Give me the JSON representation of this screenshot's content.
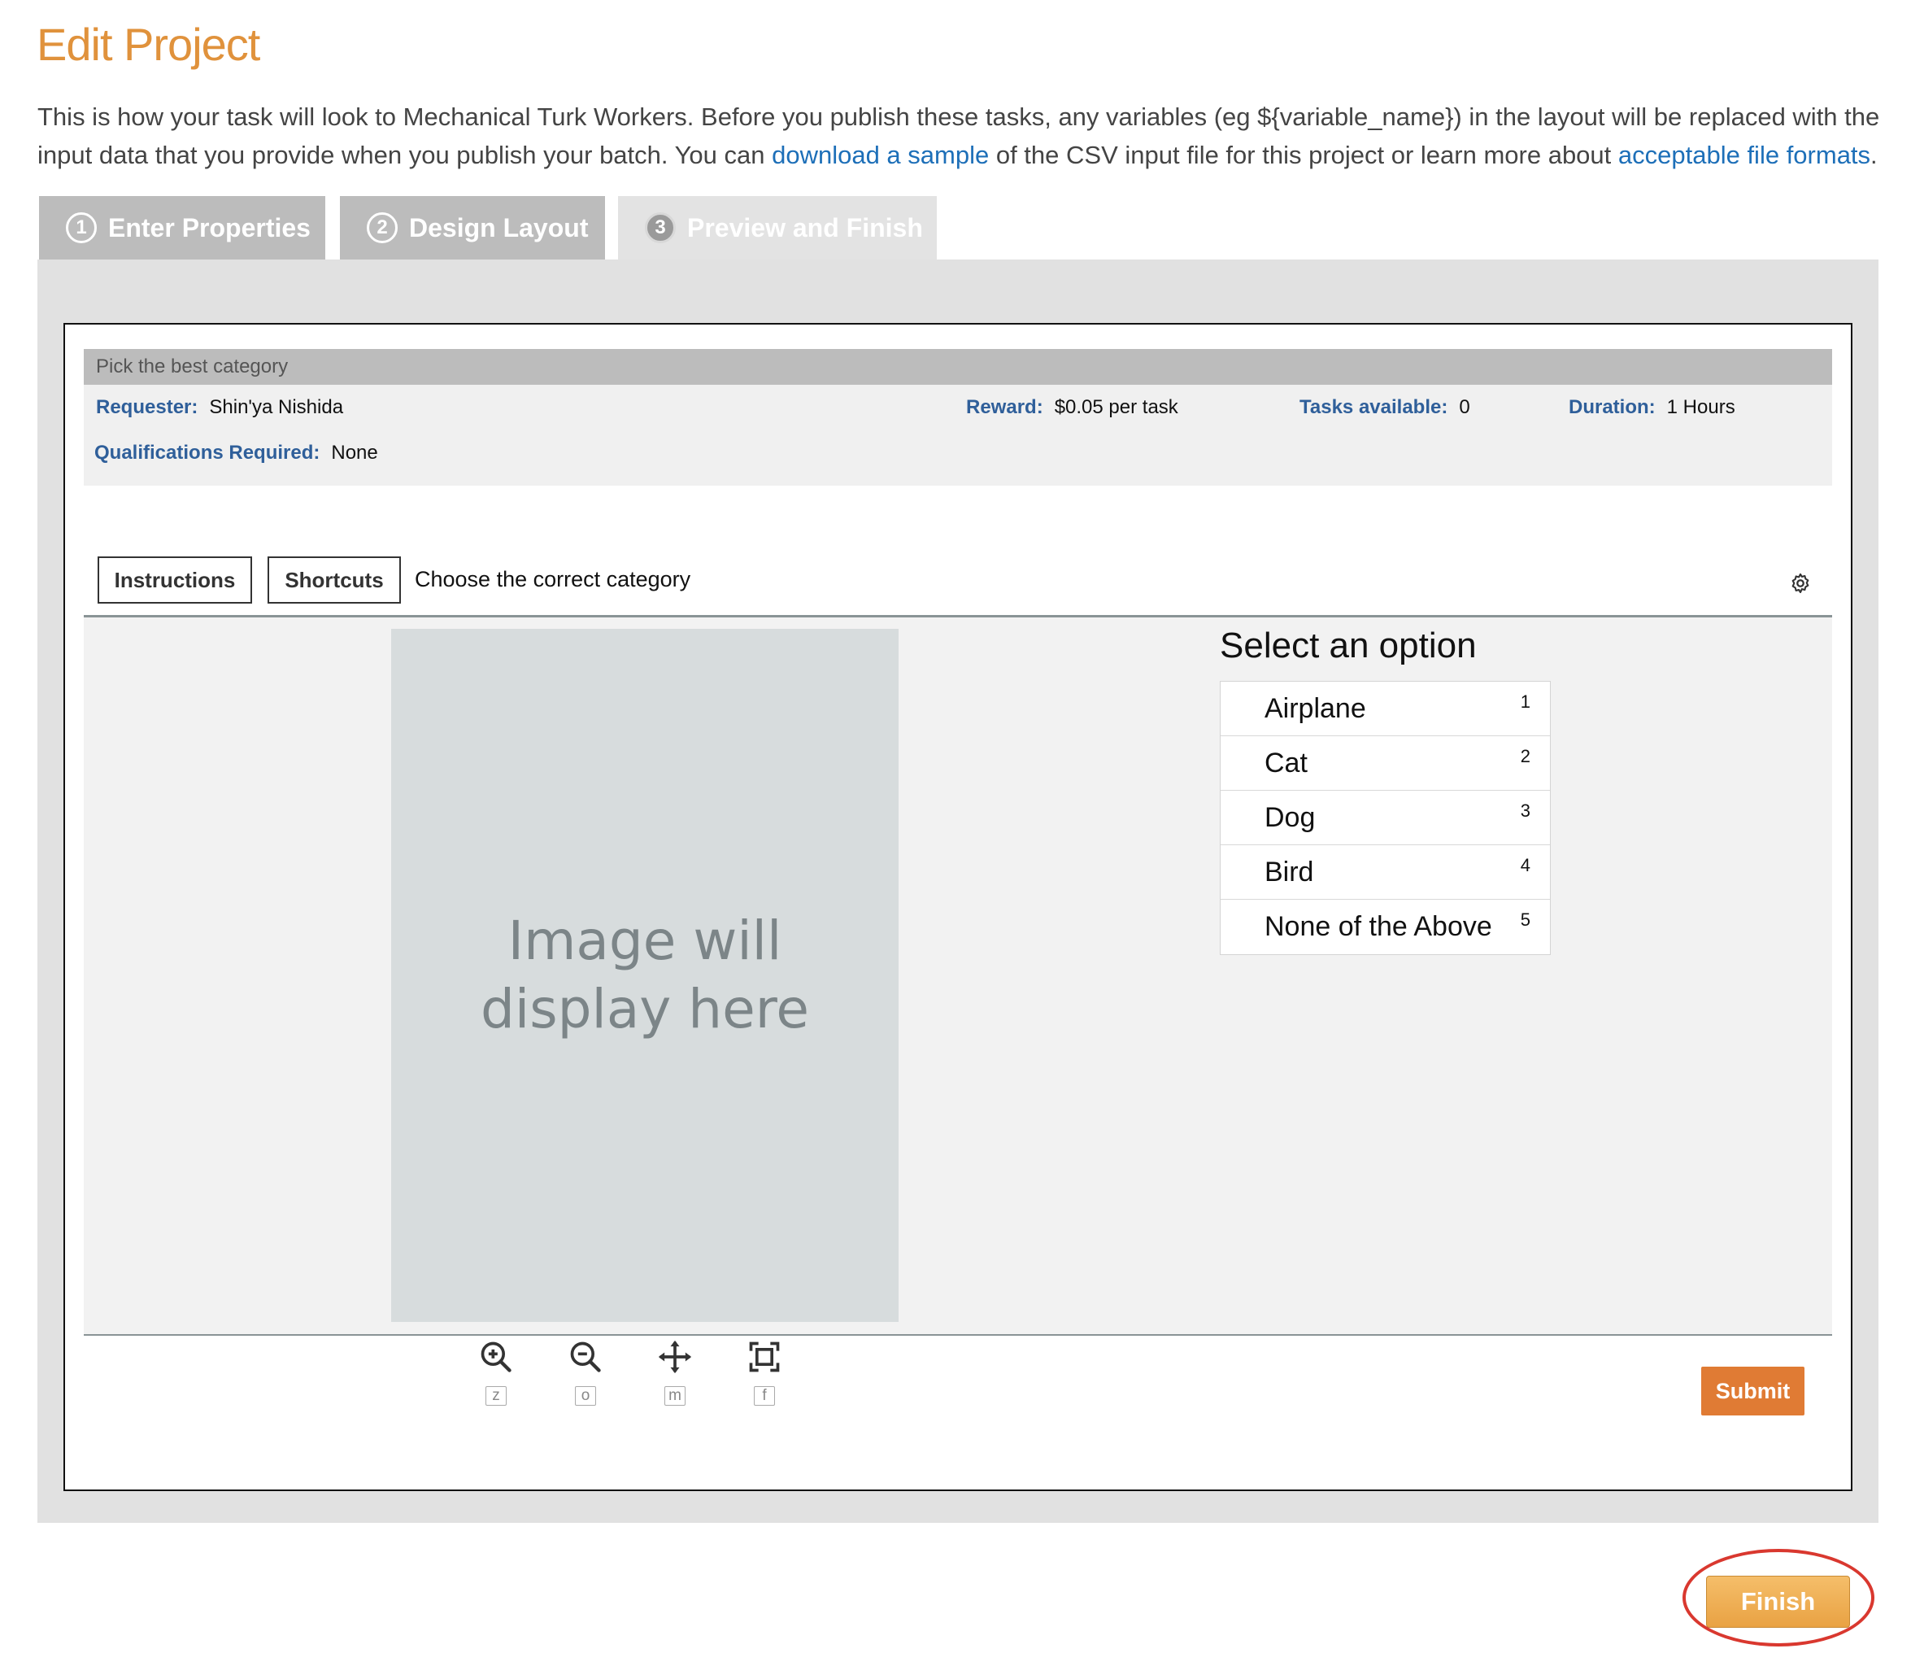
{
  "page": {
    "title": "Edit Project",
    "intro_part1": "This is how your task will look to Mechanical Turk Workers. Before you publish these tasks, any variables (eg ${variable_name}) in the layout will be replaced with the input data that you provide when you publish your batch. You can ",
    "intro_link1": "download a sample",
    "intro_part2": " of the CSV input file for this project or learn more about ",
    "intro_link2": "acceptable file formats",
    "intro_part3": "."
  },
  "tabs": [
    {
      "num": "1",
      "label": "Enter Properties"
    },
    {
      "num": "2",
      "label": "Design Layout"
    },
    {
      "num": "3",
      "label": "Preview and Finish"
    }
  ],
  "hit": {
    "title": "Pick the best category",
    "requester_label": "Requester:",
    "requester_value": "Shin'ya Nishida",
    "reward_label": "Reward:",
    "reward_value": "$0.05 per task",
    "tasks_label": "Tasks available:",
    "tasks_value": "0",
    "duration_label": "Duration:",
    "duration_value": "1 Hours",
    "quals_label": "Qualifications Required:",
    "quals_value": "None"
  },
  "task": {
    "instructions_label": "Instructions",
    "shortcuts_label": "Shortcuts",
    "prompt": "Choose the correct category",
    "image_placeholder_line1": "Image will",
    "image_placeholder_line2": "display here",
    "select_title": "Select an option",
    "options": [
      {
        "label": "Airplane",
        "key": "1"
      },
      {
        "label": "Cat",
        "key": "2"
      },
      {
        "label": "Dog",
        "key": "3"
      },
      {
        "label": "Bird",
        "key": "4"
      },
      {
        "label": "None of the Above",
        "key": "5"
      }
    ],
    "tools": [
      {
        "icon": "zoom-in-icon",
        "key": "z"
      },
      {
        "icon": "zoom-out-icon",
        "key": "o"
      },
      {
        "icon": "move-icon",
        "key": "m"
      },
      {
        "icon": "fit-icon",
        "key": "f"
      }
    ],
    "submit_label": "Submit"
  },
  "footer": {
    "finish_label": "Finish"
  },
  "colors": {
    "accent": "#e07b34",
    "title": "#e0923c",
    "link": "#1d6fb8",
    "highlight": "#d9382f"
  }
}
